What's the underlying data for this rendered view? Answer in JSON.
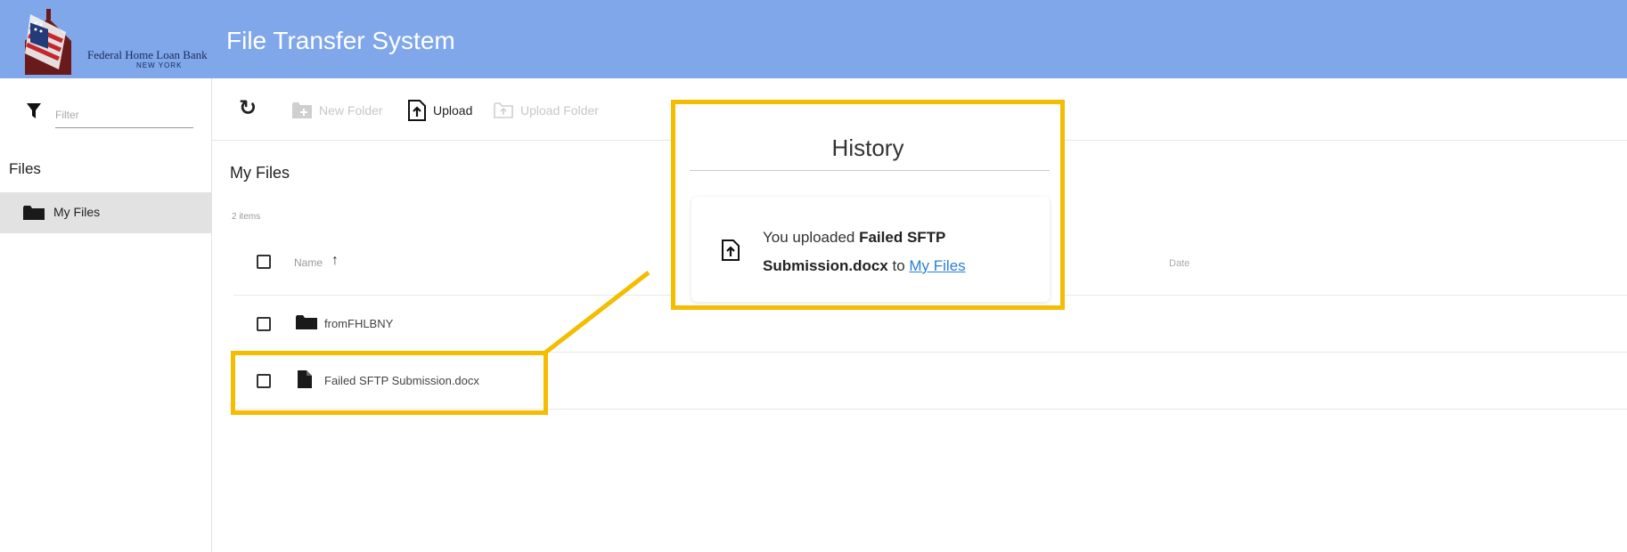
{
  "header": {
    "logo_line1": "Federal Home Loan Bank",
    "logo_line2": "NEW YORK",
    "title": "File Transfer System"
  },
  "sidebar": {
    "filter_placeholder": "Filter",
    "heading": "Files",
    "items": [
      {
        "label": "My Files",
        "icon": "folder-icon",
        "selected": true
      }
    ]
  },
  "toolbar": {
    "refresh_icon": "refresh-icon",
    "new_folder_label": "New Folder",
    "upload_label": "Upload",
    "upload_folder_label": "Upload Folder"
  },
  "main": {
    "title": "My Files",
    "item_count": "2 items",
    "columns": {
      "name": "Name",
      "date": "Date",
      "sort": "ascending"
    },
    "rows": [
      {
        "name": "fromFHLBNY",
        "type": "folder",
        "date": ""
      },
      {
        "name": "Failed SFTP Submission.docx",
        "type": "file",
        "date": ""
      }
    ]
  },
  "history": {
    "title": "History",
    "message_prefix": "You uploaded ",
    "file_name": "Failed SFTP Submission.docx",
    "message_mid": " to ",
    "destination_link": "My Files"
  },
  "colors": {
    "header_bg": "#7fa7ea",
    "highlight": "#f5bd00",
    "link": "#2a7fd6",
    "selected_bg": "#e2e2e2"
  }
}
